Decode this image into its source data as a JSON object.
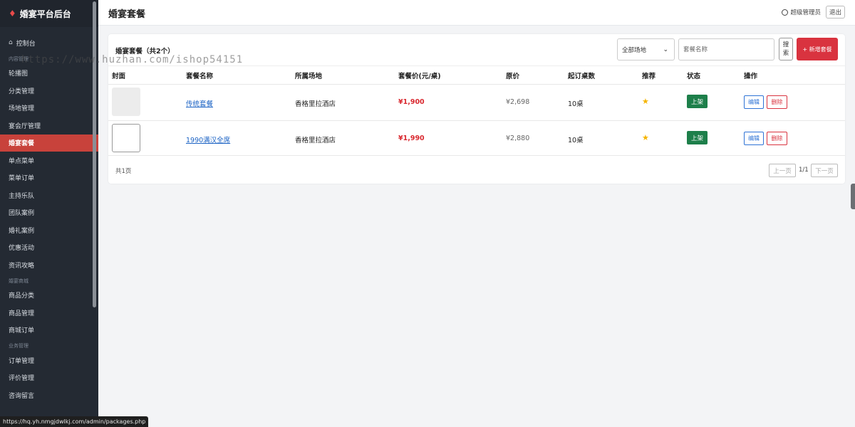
{
  "sidebar": {
    "brand": "婚宴平台后台",
    "dashboard": "控制台",
    "section_content": "内容管理",
    "items_content": [
      "轮播图",
      "分类管理",
      "场地管理",
      "宴会厅管理",
      "婚宴套餐",
      "单点菜单",
      "菜单订单",
      "主持乐队",
      "团队案例",
      "婚礼案例",
      "优惠活动",
      "资讯攻略"
    ],
    "section_mall": "婚宴商城",
    "items_mall": [
      "商品分类",
      "商品管理",
      "商城订单"
    ],
    "section_business": "业务管理",
    "items_business": [
      "订单管理",
      "评价管理",
      "咨询留言"
    ],
    "active_item": "婚宴套餐"
  },
  "header": {
    "title": "婚宴套餐",
    "admin_label": "超级管理员",
    "logout_label": "退出"
  },
  "card": {
    "title": "婚宴套餐（共2个）",
    "venue_select": "全部场地",
    "search_placeholder": "套餐名称",
    "search_button": "搜索",
    "add_button": "+ 新增套餐"
  },
  "table": {
    "columns": [
      "封面",
      "套餐名称",
      "所属场地",
      "套餐价(元/桌)",
      "原价",
      "起订桌数",
      "推荐",
      "状态",
      "操作"
    ],
    "rows": [
      {
        "name": "传统套餐",
        "venue": "香格里拉酒店",
        "price": "¥1,900",
        "original": "¥2,698",
        "min_tables": "10桌",
        "recommended": "★",
        "status": "上架",
        "edit": "编辑",
        "delete": "删除"
      },
      {
        "name": "1990满汉全席",
        "venue": "香格里拉酒店",
        "price": "¥1,990",
        "original": "¥2,880",
        "min_tables": "10桌",
        "recommended": "★",
        "status": "上架",
        "edit": "编辑",
        "delete": "删除"
      }
    ]
  },
  "pagination": {
    "total": "共1页",
    "prev": "上一页",
    "info": "1/1",
    "next": "下一页"
  },
  "overlay": {
    "watermark": "https://www.huzhan.com/ishop54151",
    "status_url": "https://hq.yh.nmgjdwlkj.com/admin/packages.php"
  },
  "colors": {
    "sidebar_bg": "#242a33",
    "active": "#c8423b",
    "accent_red": "#d9333f",
    "status_green": "#1d7f4a",
    "link_blue": "#1a62c4"
  }
}
